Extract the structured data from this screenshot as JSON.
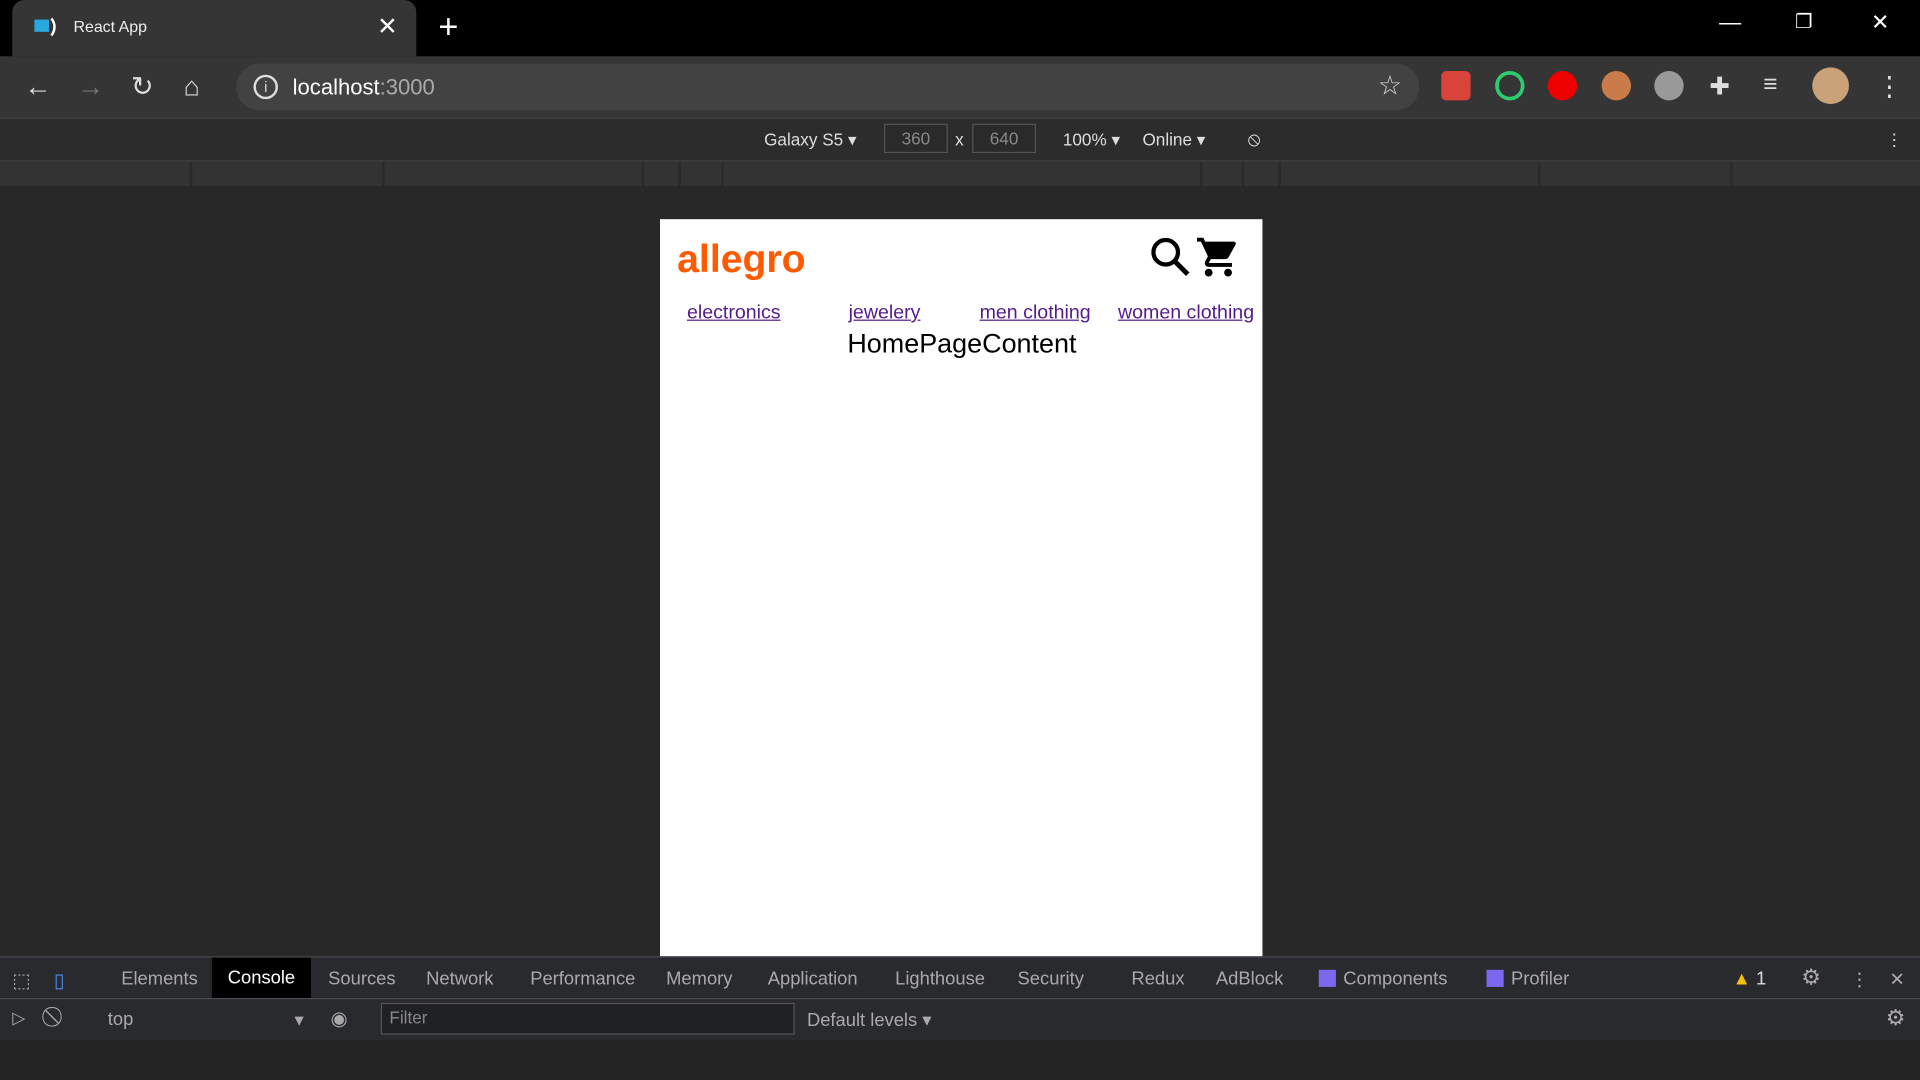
{
  "browser": {
    "tab_title": "React App",
    "url_host": "localhost",
    "url_port": ":3000"
  },
  "device_toolbar": {
    "device": "Galaxy S5",
    "width": "360",
    "times": "x",
    "height": "640",
    "zoom": "100%",
    "network": "Online"
  },
  "app": {
    "logo": "allegro",
    "categories": [
      "electronics",
      "jewelery",
      "men clothing",
      "women clothing"
    ],
    "content": "HomePageContent"
  },
  "devtools": {
    "tabs": [
      "Elements",
      "Console",
      "Sources",
      "Network",
      "Performance",
      "Memory",
      "Application",
      "Lighthouse",
      "Security",
      "Redux",
      "AdBlock",
      "Components",
      "Profiler"
    ],
    "active_tab": "Console",
    "warning_count": "1",
    "context": "top",
    "filter_placeholder": "Filter",
    "levels": "Default levels"
  }
}
